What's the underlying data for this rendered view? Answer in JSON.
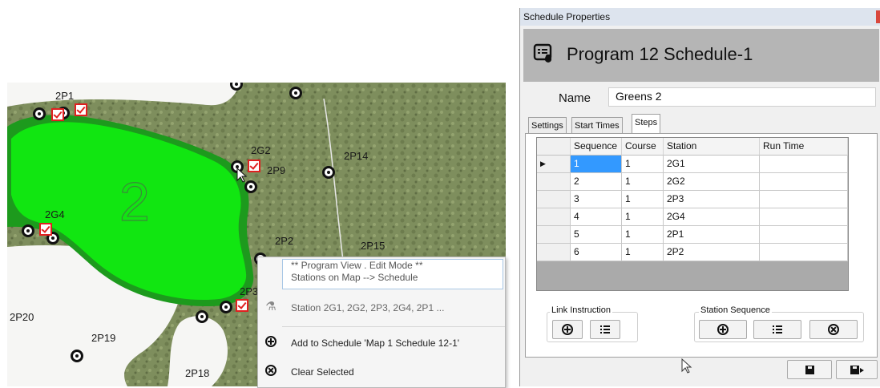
{
  "map": {
    "labels": {
      "p1": "2P1",
      "g2": "2G2",
      "p9": "2P9",
      "p14": "2P14",
      "g4": "2G4",
      "p2": "2P2",
      "p15": "2P15",
      "p3": "2P3",
      "p20": "2P20",
      "p19": "2P19",
      "p18": "2P18"
    },
    "green_number": "2",
    "colors": {
      "green": "#11e611",
      "green_edge": "#1d9a1d",
      "grass": "#7e8e5d",
      "sand": "#f6f6f4"
    }
  },
  "context_menu": {
    "header_line1": "** Program View . Edit Mode **",
    "header_line2": "Stations on Map --> Schedule",
    "station_item": "Station 2G1, 2G2, 2P3, 2G4, 2P1 ...",
    "add_item": "Add to Schedule 'Map 1 Schedule 12-1'",
    "clear_item": "Clear Selected"
  },
  "dialog": {
    "window_title": "Schedule Properties",
    "header_title": "Program 12 Schedule-1",
    "name_label": "Name",
    "name_value": "Greens 2",
    "tabs": [
      {
        "label": "Settings"
      },
      {
        "label": "Start Times"
      },
      {
        "label": "Steps"
      }
    ],
    "grid": {
      "columns": [
        "Sequence",
        "Course",
        "Station",
        "Run Time"
      ],
      "rows": [
        {
          "sequence": "1",
          "course": "1",
          "station": "2G1",
          "run_time": ""
        },
        {
          "sequence": "2",
          "course": "1",
          "station": "2G2",
          "run_time": ""
        },
        {
          "sequence": "3",
          "course": "1",
          "station": "2P3",
          "run_time": ""
        },
        {
          "sequence": "4",
          "course": "1",
          "station": "2G4",
          "run_time": ""
        },
        {
          "sequence": "5",
          "course": "1",
          "station": "2P1",
          "run_time": ""
        },
        {
          "sequence": "6",
          "course": "1",
          "station": "2P2",
          "run_time": ""
        }
      ]
    },
    "link_instruction_label": "Link Instruction",
    "station_sequence_label": "Station Sequence",
    "selection_color": "#3399ff"
  }
}
